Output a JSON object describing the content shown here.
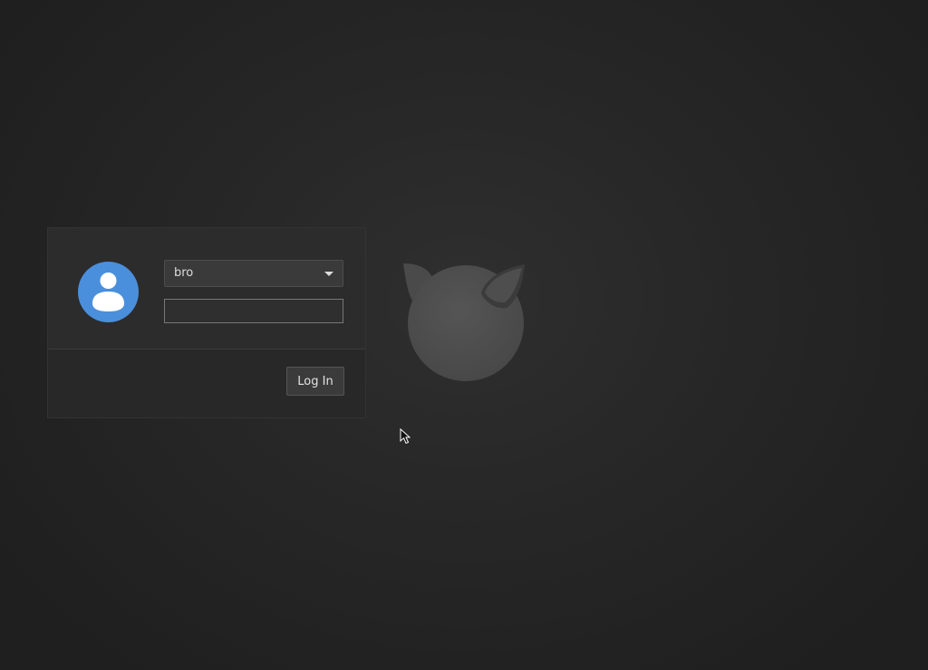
{
  "login": {
    "selected_user": "bro",
    "password_value": "",
    "password_placeholder": "",
    "button_label": "Log In"
  },
  "icons": {
    "avatar": "user-avatar-icon",
    "dropdown": "chevron-down-icon",
    "logo": "daemon-logo-icon",
    "cursor": "mouse-pointer-icon"
  },
  "colors": {
    "avatar_blue": "#4a8fdc",
    "panel": "#2a2a2a",
    "background": "#242424"
  }
}
